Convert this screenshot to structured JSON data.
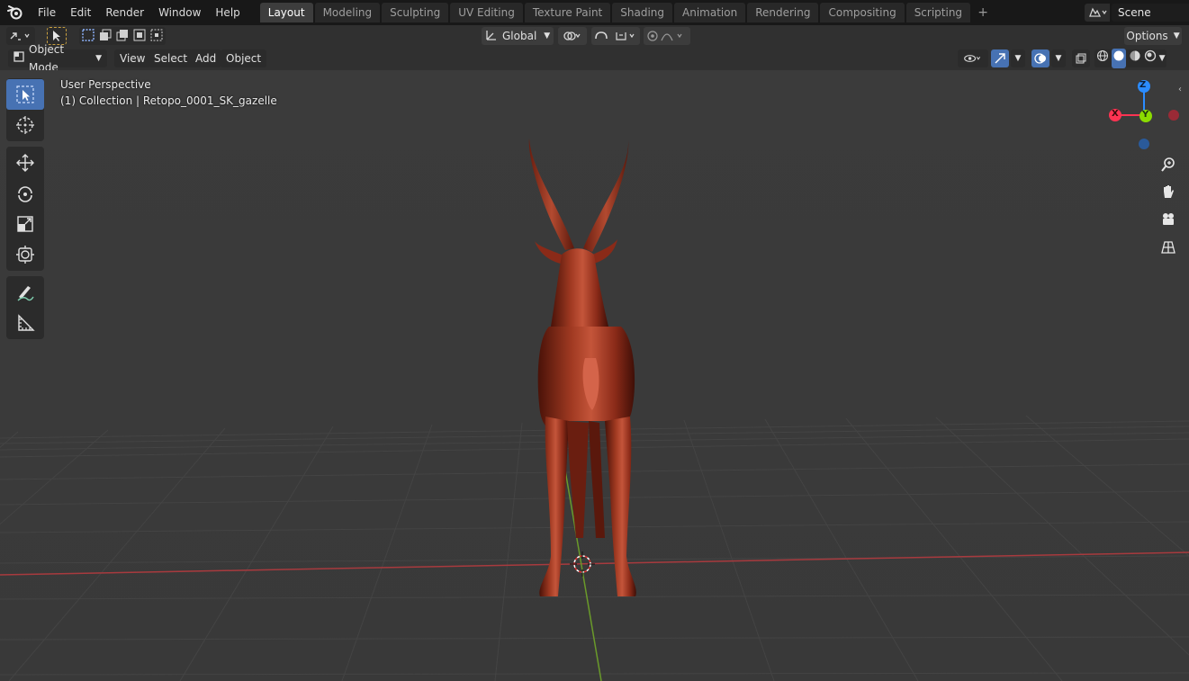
{
  "topbar": {
    "menus": [
      "File",
      "Edit",
      "Render",
      "Window",
      "Help"
    ],
    "workspaces": [
      {
        "label": "Layout",
        "active": true
      },
      {
        "label": "Modeling",
        "active": false
      },
      {
        "label": "Sculpting",
        "active": false
      },
      {
        "label": "UV Editing",
        "active": false
      },
      {
        "label": "Texture Paint",
        "active": false
      },
      {
        "label": "Shading",
        "active": false
      },
      {
        "label": "Animation",
        "active": false
      },
      {
        "label": "Rendering",
        "active": false
      },
      {
        "label": "Compositing",
        "active": false
      },
      {
        "label": "Scripting",
        "active": false
      }
    ],
    "add_workspace": "+",
    "scene": "Scene"
  },
  "toolheader": {
    "orientation": "Global",
    "options": "Options"
  },
  "vpheader": {
    "mode": "Object Mode",
    "menus": [
      "View",
      "Select",
      "Add",
      "Object"
    ]
  },
  "viewport": {
    "perspective_label": "User Perspective",
    "collection_label": "(1) Collection | Retopo_0001_SK_gazelle",
    "gizmo": {
      "z": "Z",
      "x": "X",
      "y": "Y"
    }
  },
  "colors": {
    "accent": "#4772b3",
    "model": "#8a2a18",
    "x_axis": "#ff3352",
    "y_axis": "#8bdc00",
    "z_axis": "#2b8cff"
  }
}
